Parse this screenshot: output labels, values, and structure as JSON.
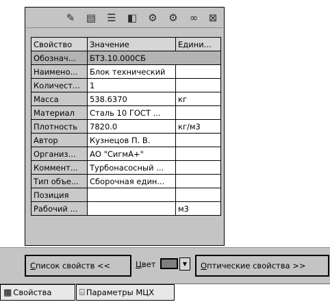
{
  "toolbar": {
    "icons": [
      "question-tool-icon",
      "document-icon",
      "list-icon",
      "folder-icon",
      "properties-icon",
      "properties-gear-icon",
      "link-icon",
      "delete-column-icon"
    ]
  },
  "table": {
    "headers": [
      "Свойство",
      "Значение",
      "Едини..."
    ],
    "rows": [
      {
        "name": "Обознач...",
        "value": "БТ3.10.000СБ",
        "unit": ""
      },
      {
        "name": "Наимено...",
        "value": "Блок технический",
        "unit": ""
      },
      {
        "name": "Количест...",
        "value": "1",
        "unit": ""
      },
      {
        "name": "Масса",
        "value": "538.6370",
        "unit": "кг"
      },
      {
        "name": "Материал",
        "value": "Сталь 10  ГОСТ ...",
        "unit": ""
      },
      {
        "name": "Плотность",
        "value": "7820.0",
        "unit": "кг/м3"
      },
      {
        "name": "Автор",
        "value": "Кузнецов П. В.",
        "unit": ""
      },
      {
        "name": "Организ...",
        "value": "АО \"СигмА+\"",
        "unit": ""
      },
      {
        "name": "Коммент...",
        "value": "Турбонасосный ...",
        "unit": ""
      },
      {
        "name": "Тип объе...",
        "value": "Сборочная един...",
        "unit": ""
      },
      {
        "name": "Позиция",
        "value": "",
        "unit": ""
      },
      {
        "name": "Рабочий ...",
        "value": "",
        "unit": "м3"
      }
    ]
  },
  "bottom": {
    "list_btn_u": "С",
    "list_btn_rest": "писок свойств  <<",
    "color_u": "Ц",
    "color_rest": "вет",
    "color_value": "#7f7f7f",
    "optical_btn_u": "О",
    "optical_btn_rest": "птические свойства  >>"
  },
  "tabs": [
    {
      "label": "Свойства",
      "icon": "properties-tab-icon"
    },
    {
      "label": "Параметры МЦХ",
      "icon": "mass-params-tab-icon"
    }
  ]
}
